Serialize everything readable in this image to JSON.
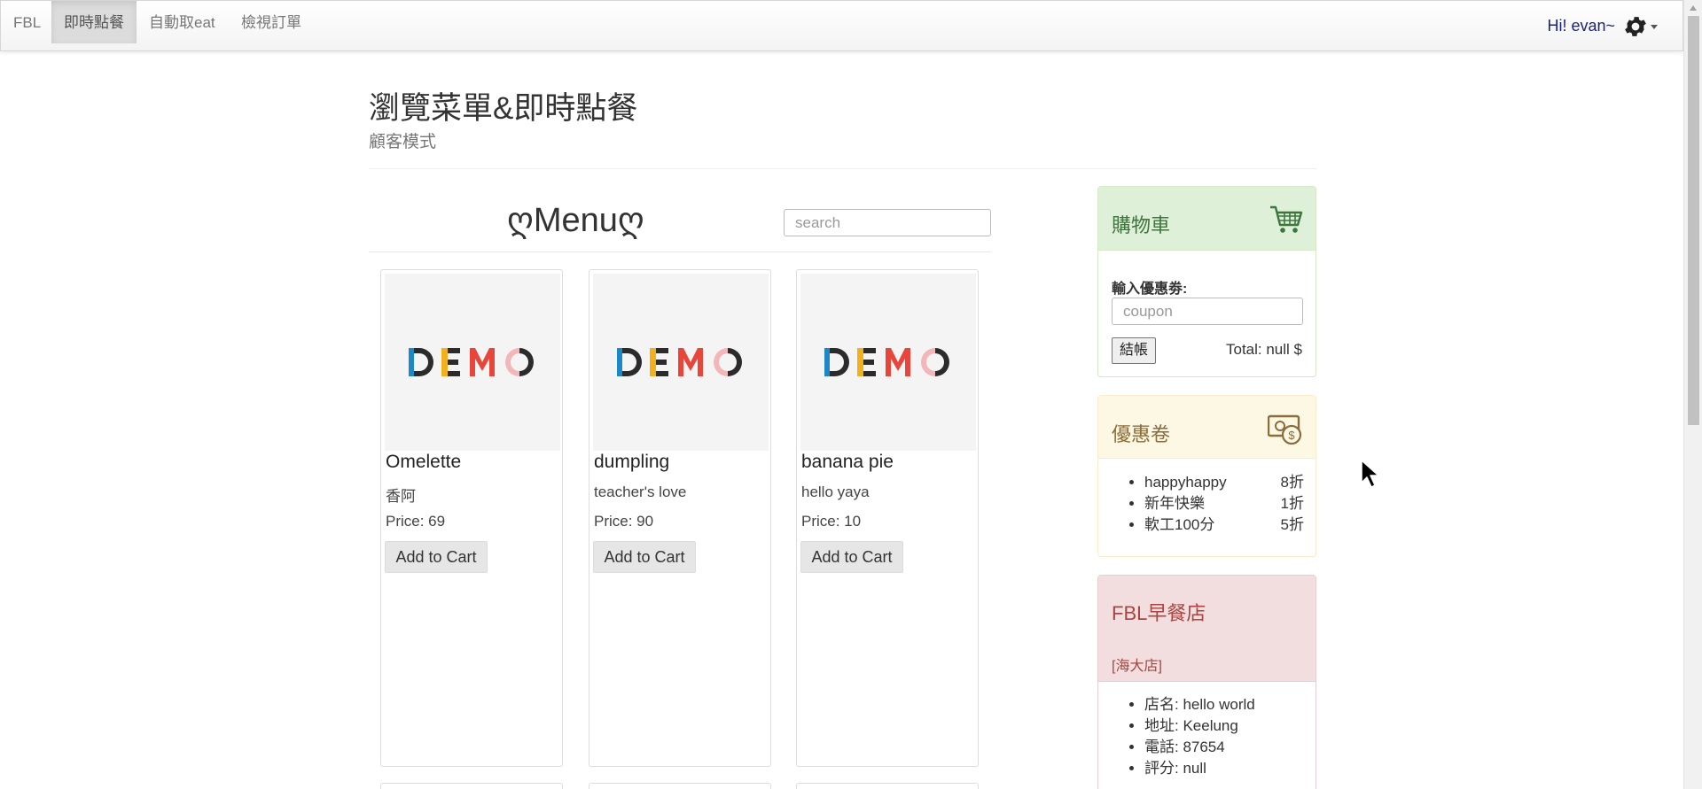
{
  "nav": {
    "brand": "FBL",
    "items": [
      "即時點餐",
      "自動取eat",
      "檢視訂單"
    ],
    "user_greeting": "Hi! evan~",
    "settings_icon": "gear-icon"
  },
  "header": {
    "title": "瀏覽菜單&即時點餐",
    "subtitle": "顧客模式"
  },
  "menu": {
    "title": "ღMenuღ",
    "search_placeholder": "search",
    "products": [
      {
        "image_text": "DEMO",
        "name": "Omelette",
        "description": "香阿",
        "price": "Price: 69",
        "button": "Add to Cart"
      },
      {
        "image_text": "DEMO",
        "name": "dumpling",
        "description": "teacher's love",
        "price": "Price: 90",
        "button": "Add to Cart"
      },
      {
        "image_text": "DEMO",
        "name": "banana pie",
        "description": "hello yaya",
        "price": "Price: 10",
        "button": "Add to Cart"
      }
    ]
  },
  "cart": {
    "title": "購物車",
    "icon": "shopping-cart-icon",
    "coupon_label": "輸入優惠劵:",
    "coupon_placeholder": "coupon",
    "checkout_label": "結帳",
    "total": "Total: null $"
  },
  "coupons": {
    "title": "優惠卷",
    "icon": "money-icon",
    "items": [
      {
        "name": "happyhappy",
        "discount": "8折"
      },
      {
        "name": "新年快樂",
        "discount": "1折"
      },
      {
        "name": "軟工100分",
        "discount": "5折"
      }
    ]
  },
  "store": {
    "title": "FBL早餐店",
    "branch": "[海大店]",
    "details": [
      "店名: hello world",
      "地址: Keelung",
      "電話: 87654",
      "評分: null"
    ]
  },
  "colors": {
    "cart_header_bg": "#dff0d8",
    "cart_header_text": "#3c763d",
    "coupon_header_bg": "#fcf8e3",
    "coupon_header_text": "#8a6d3b",
    "store_header_bg": "#f2dede",
    "store_header_text": "#a94442",
    "user_greeting": "#1a237e"
  }
}
